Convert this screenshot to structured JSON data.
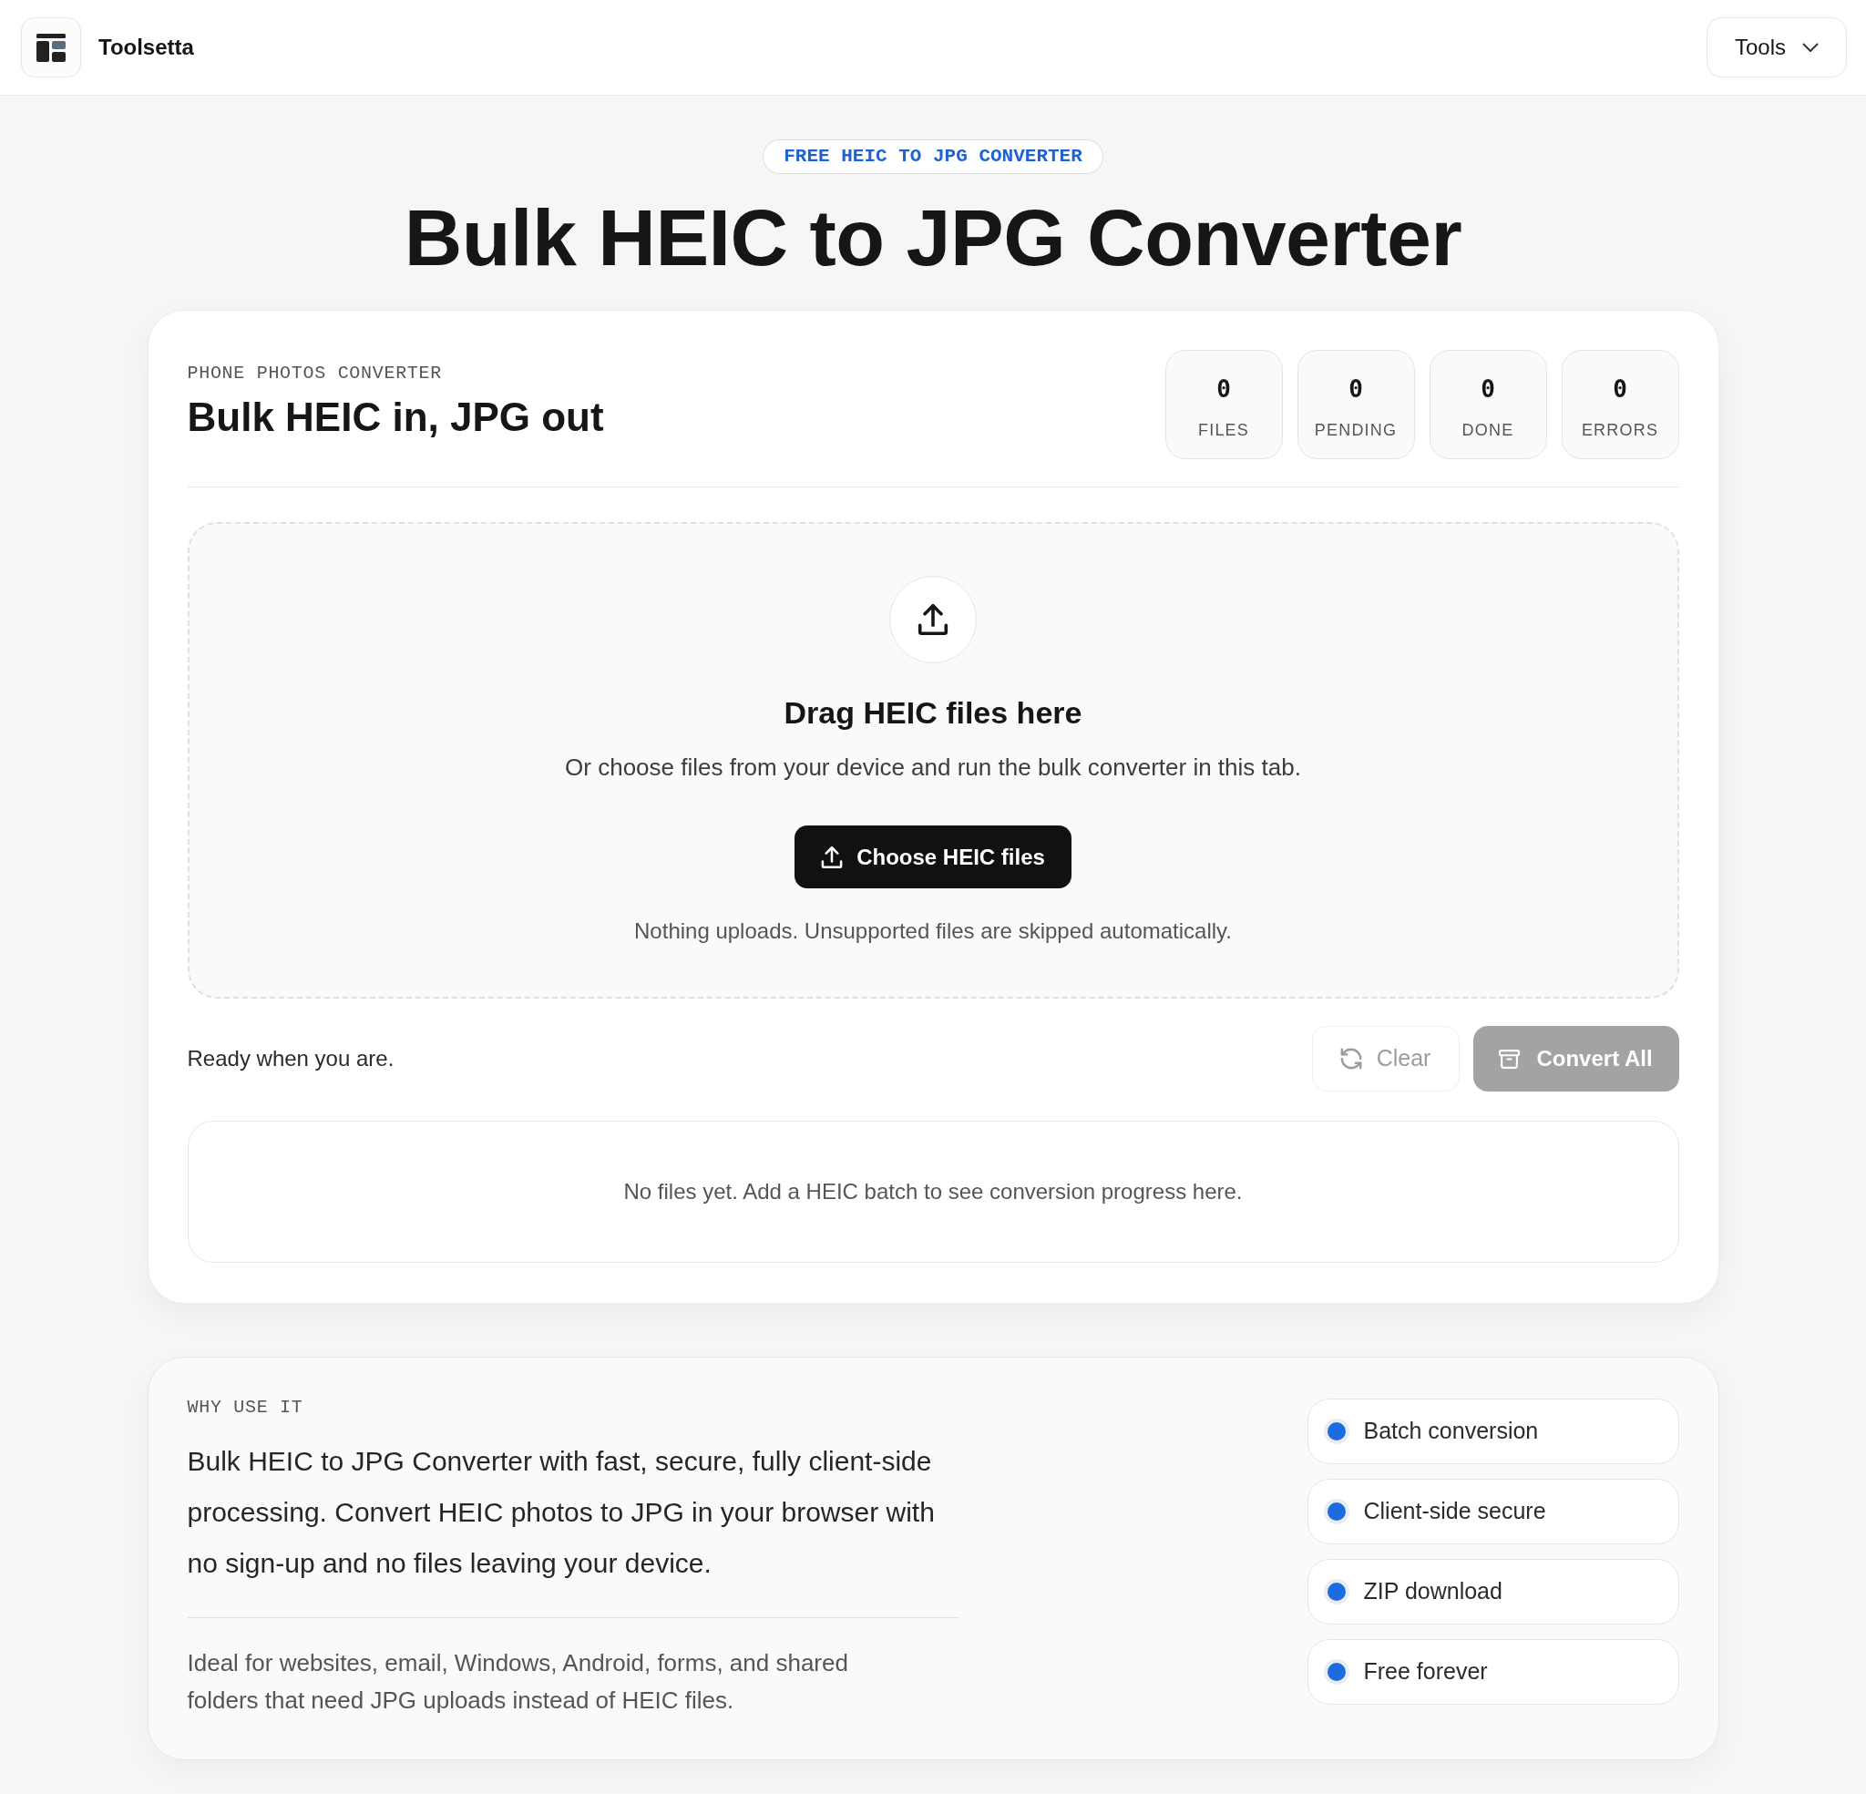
{
  "header": {
    "brand": "Toolsetta",
    "menu_button": "Tools"
  },
  "hero": {
    "badge": "FREE HEIC TO JPG CONVERTER",
    "title": "Bulk HEIC to JPG Converter"
  },
  "converter": {
    "eyebrow": "PHONE PHOTOS CONVERTER",
    "title": "Bulk HEIC in, JPG out",
    "stats": [
      {
        "value": "0",
        "label": "FILES"
      },
      {
        "value": "0",
        "label": "PENDING"
      },
      {
        "value": "0",
        "label": "DONE"
      },
      {
        "value": "0",
        "label": "ERRORS"
      }
    ],
    "dropzone": {
      "title": "Drag HEIC files here",
      "subtitle": "Or choose files from your device and run the bulk converter in this tab.",
      "button": "Choose HEIC files",
      "note": "Nothing uploads. Unsupported files are skipped automatically."
    },
    "status": "Ready when you are.",
    "actions": [
      {
        "kind": "clear",
        "label": "Clear",
        "disabled": true
      },
      {
        "kind": "convert",
        "label": "Convert All",
        "disabled": true
      }
    ],
    "empty_state": "No files yet. Add a HEIC batch to see conversion progress here."
  },
  "why": {
    "eyebrow": "WHY USE IT",
    "text": "Bulk HEIC to JPG Converter with fast, secure, fully client-side processing. Convert HEIC photos to JPG in your browser with no sign-up and no files leaving your device.",
    "note": "Ideal for websites, email, Windows, Android, forms, and shared folders that need JPG uploads instead of HEIC files.",
    "features": [
      "Batch conversion",
      "Client-side secure",
      "ZIP download",
      "Free forever"
    ]
  }
}
